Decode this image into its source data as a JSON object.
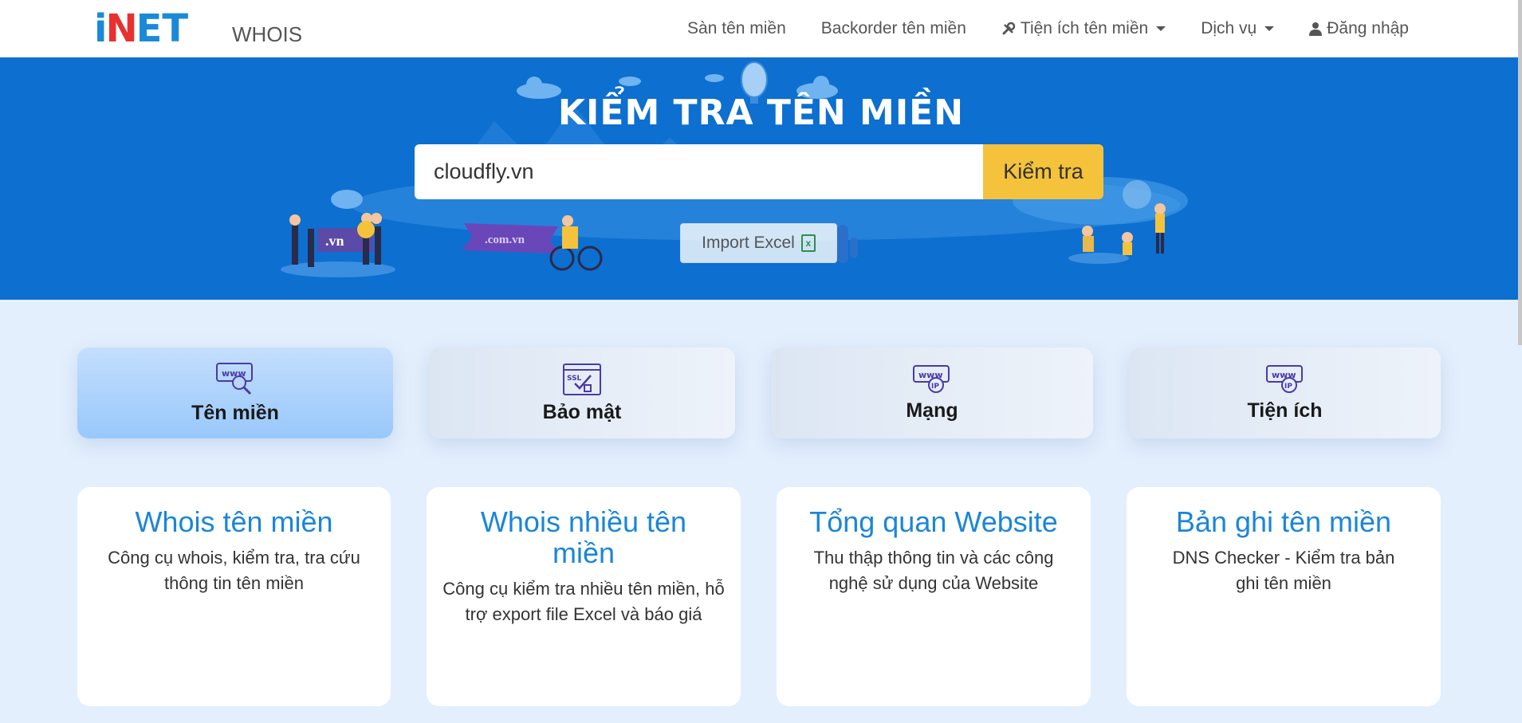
{
  "brand": {
    "logo_i": "i",
    "logo_n": "N",
    "logo_et": "ET",
    "product": "WHOIS"
  },
  "nav": {
    "items": [
      {
        "label": "Sàn tên miền"
      },
      {
        "label": "Backorder tên miền"
      },
      {
        "label": "Tiện ích tên miền",
        "icon": "tools-icon"
      },
      {
        "label": "Dịch vụ"
      },
      {
        "label": "Đăng nhập",
        "icon": "user-icon"
      }
    ]
  },
  "hero": {
    "title": "KIỂM TRA TÊN MIỀN",
    "search_value": "cloudfly.vn",
    "search_button": "Kiểm tra",
    "import_button": "Import Excel",
    "illustration_texts": {
      "vn": ".vn",
      "comvn": ".com.vn"
    }
  },
  "tabs": [
    {
      "label": "Tên miền",
      "icon": "www-search-icon",
      "active": true
    },
    {
      "label": "Bảo mật",
      "icon": "ssl-icon",
      "active": false
    },
    {
      "label": "Mạng",
      "icon": "www-ip-icon",
      "active": false
    },
    {
      "label": "Tiện ích",
      "icon": "www-ip-icon",
      "active": false
    }
  ],
  "cards": [
    {
      "title": "Whois tên miền",
      "desc": "Công cụ whois, kiểm tra, tra cứu thông tin tên miền"
    },
    {
      "title": "Whois nhiều tên miền",
      "desc": "Công cụ kiểm tra nhiều tên miền, hỗ trợ export file Excel và báo giá"
    },
    {
      "title": "Tổng quan Website",
      "desc": "Thu thập thông tin và các công nghệ sử dụng của Website"
    },
    {
      "title": "Bản ghi tên miền",
      "desc": "DNS Checker - Kiểm tra bản ghi tên miền"
    }
  ],
  "colors": {
    "hero_bg": "#0d6fcf",
    "accent_button": "#f5c23c",
    "card_title": "#1a86d9",
    "page_bg": "#e3effd"
  }
}
